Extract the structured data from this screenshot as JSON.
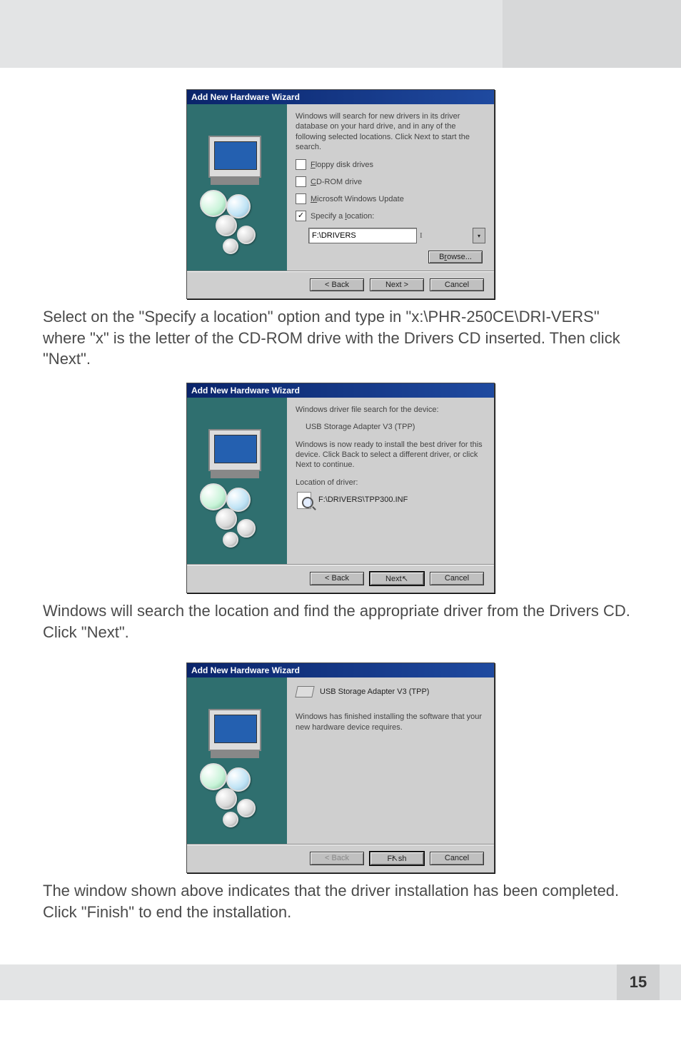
{
  "page_number": "15",
  "dialog1": {
    "title": "Add New Hardware Wizard",
    "intro": "Windows will search for new drivers in its driver database on your hard drive, and in any of the following selected locations. Click Next to start the search.",
    "opt_floppy_prefix": "F",
    "opt_floppy_rest": "loppy disk drives",
    "opt_cdrom_prefix": "C",
    "opt_cdrom_rest": "D-ROM drive",
    "opt_msupdate_prefix": "M",
    "opt_msupdate_rest": "icrosoft Windows Update",
    "opt_specify_prefix": "Specify a ",
    "opt_specify_under": "l",
    "opt_specify_rest": "ocation:",
    "path_value": "F:\\DRIVERS",
    "browse_prefix": "B",
    "browse_under": "r",
    "browse_rest": "owse...",
    "back_label": "< Back",
    "next_label": "Next >",
    "cancel_label": "Cancel"
  },
  "caption1": "Select on the \"Specify a location\" option and type in \"x:\\PHR-250CE\\DRI-VERS\" where \"x\" is the letter of the CD-ROM drive with the Drivers CD inserted. Then click \"Next\".",
  "dialog2": {
    "title": "Add New Hardware Wizard",
    "line1": "Windows driver file search for the device:",
    "device": "USB Storage Adapter V3 (TPP)",
    "line2": "Windows is now ready to install the best driver for this device. Click Back to select a different driver, or click Next to continue.",
    "loc_label": "Location of driver:",
    "loc_value": "F:\\DRIVERS\\TPP300.INF",
    "back_label": "< Back",
    "next_label": "Next ",
    "cancel_label": "Cancel"
  },
  "caption2": "Windows will search the location and find the appropriate driver from the Drivers CD. Click \"Next\".",
  "dialog3": {
    "title": "Add New Hardware Wizard",
    "device": "USB Storage Adapter V3 (TPP)",
    "message": "Windows has finished installing the software that your new hardware device requires.",
    "back_label": "< Back",
    "finish_label": "Finish",
    "cancel_label": "Cancel"
  },
  "caption3": "The window shown above indicates that the driver installation has been completed. Click \"Finish\" to end the installation."
}
